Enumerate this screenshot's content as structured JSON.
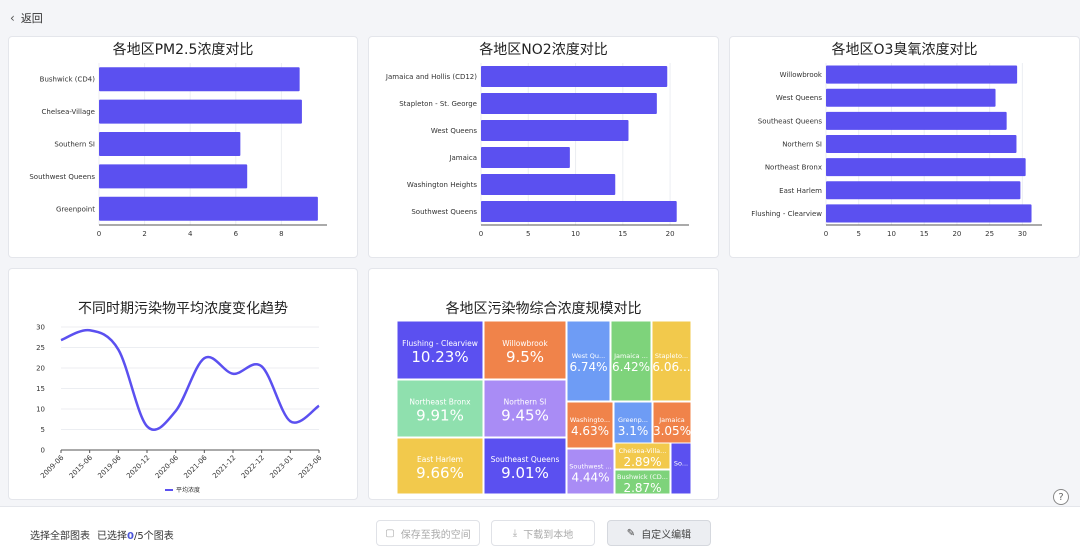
{
  "topbar": {
    "back_label": "返回"
  },
  "charts": [
    {
      "title": "各地区PM2.5浓度对比",
      "chart_data": {
        "type": "bar",
        "orientation": "horizontal",
        "categories": [
          "Bushwick (CD4)",
          "Chelsea-Village",
          "Southern SI",
          "Southwest Queens",
          "Greenpoint"
        ],
        "values": [
          8.8,
          8.9,
          6.2,
          6.5,
          9.6
        ],
        "xlim": [
          0,
          10
        ],
        "xticks": [
          0,
          2,
          4,
          6,
          8
        ],
        "color": "#5b50f0"
      }
    },
    {
      "title": "各地区NO2浓度对比",
      "chart_data": {
        "type": "bar",
        "orientation": "horizontal",
        "categories": [
          "Jamaica and Hollis (CD12)",
          "Stapleton - St. George",
          "West Queens",
          "Jamaica",
          "Washington Heights",
          "Southwest Queens"
        ],
        "values": [
          19.7,
          18.6,
          15.6,
          9.4,
          14.2,
          20.7
        ],
        "xlim": [
          0,
          22
        ],
        "xticks": [
          0,
          5,
          10,
          15,
          20
        ],
        "color": "#5b50f0"
      }
    },
    {
      "title": "各地区O3臭氧浓度对比",
      "chart_data": {
        "type": "bar",
        "orientation": "horizontal",
        "categories": [
          "Willowbrook",
          "West Queens",
          "Southeast Queens",
          "Northern SI",
          "Northeast Bronx",
          "East Harlem",
          "Flushing - Clearview"
        ],
        "values": [
          29.2,
          25.9,
          27.6,
          29.1,
          30.5,
          29.7,
          31.4
        ],
        "xlim": [
          0,
          33
        ],
        "xticks": [
          0,
          5,
          10,
          15,
          20,
          25,
          30
        ],
        "color": "#5b50f0"
      }
    },
    {
      "title": "不同时期污染物平均浓度变化趋势",
      "chart_data": {
        "type": "line",
        "x": [
          "2009-06",
          "2015-06",
          "2019-06",
          "2020-12",
          "2020-06",
          "2021-06",
          "2021-12",
          "2022-12",
          "2023-01",
          "2023-06"
        ],
        "series": [
          {
            "name": "平均浓度",
            "values": [
              26.8,
              29.2,
              24.5,
              5.8,
              9.5,
              22.4,
              18.6,
              20.4,
              7.0,
              10.8
            ]
          }
        ],
        "ylim": [
          0,
          30
        ],
        "yticks": [
          0,
          5,
          10,
          15,
          20,
          25,
          30
        ],
        "color": "#5b50f0"
      }
    },
    {
      "title": "各地区污染物综合浓度规模对比",
      "chart_data": {
        "type": "treemap",
        "items": [
          {
            "name": "Flushing - Clearview",
            "value": "10.23%",
            "color": "#5b50f0"
          },
          {
            "name": "Willowbrook",
            "value": "9.5%",
            "color": "#f0834a"
          },
          {
            "name": "West Qu...",
            "value": "6.74%",
            "color": "#6e9cf5"
          },
          {
            "name": "Jamaica ...",
            "value": "6.42%",
            "color": "#7ed37b"
          },
          {
            "name": "Stapleto...",
            "value": "6.06...",
            "color": "#f2c94c"
          },
          {
            "name": "Northeast Bronx",
            "value": "9.91%",
            "color": "#8fe0ae"
          },
          {
            "name": "Northern SI",
            "value": "9.45%",
            "color": "#a98cf5"
          },
          {
            "name": "Washingto...",
            "value": "4.63%",
            "color": "#f0834a"
          },
          {
            "name": "Greenp...",
            "value": "3.1%",
            "color": "#6e9cf5"
          },
          {
            "name": "Jamaica",
            "value": "3.05%",
            "color": "#f0834a"
          },
          {
            "name": "East Harlem",
            "value": "9.66%",
            "color": "#f2c94c"
          },
          {
            "name": "Southeast Queens",
            "value": "9.01%",
            "color": "#5b50f0"
          },
          {
            "name": "Southwest ...",
            "value": "4.44%",
            "color": "#a98cf5"
          },
          {
            "name": "Chelsea-Villa...",
            "value": "2.89%",
            "color": "#f2c94c"
          },
          {
            "name": "Bushwick (CD...",
            "value": "2.87%",
            "color": "#7ed37b"
          },
          {
            "name": "So...",
            "value": "",
            "color": "#5b50f0"
          }
        ]
      }
    }
  ],
  "footer": {
    "select_all": "选择全部图表",
    "selected_prefix": "已选择",
    "selected_count": "0",
    "selected_suffix": "/5个图表",
    "save_label": "保存至我的空间",
    "download_label": "下载到本地",
    "edit_label": "自定义编辑"
  }
}
